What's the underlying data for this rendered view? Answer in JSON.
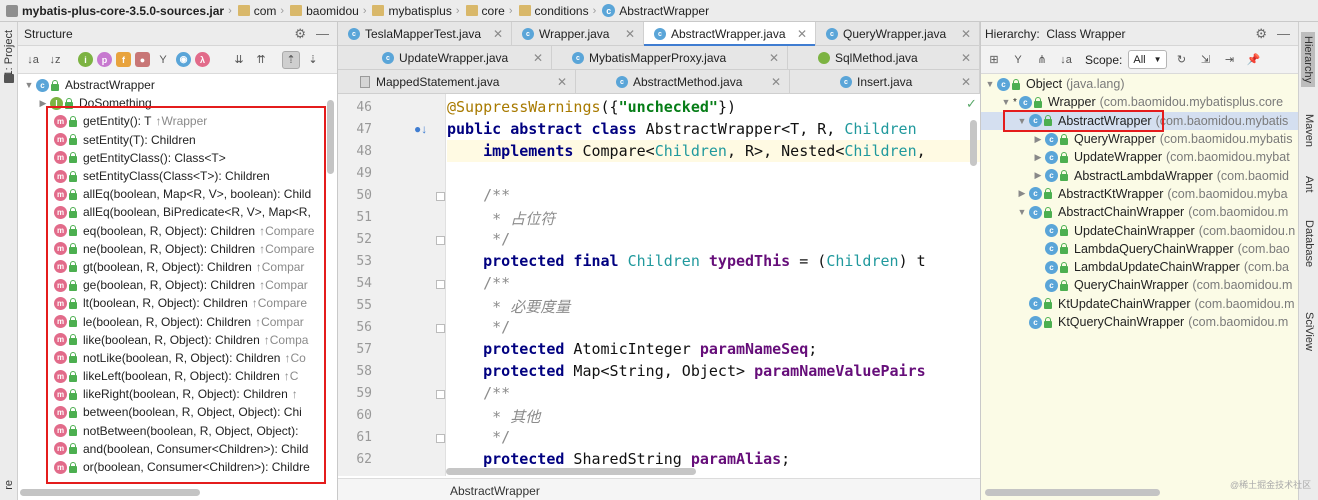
{
  "breadcrumb": [
    {
      "label": "mybatis-plus-core-3.5.0-sources.jar",
      "icon": "jar-icon",
      "bold": true
    },
    {
      "label": "com",
      "icon": "folder-icon"
    },
    {
      "label": "baomidou",
      "icon": "folder-icon"
    },
    {
      "label": "mybatisplus",
      "icon": "folder-icon"
    },
    {
      "label": "core",
      "icon": "folder-icon"
    },
    {
      "label": "conditions",
      "icon": "folder-icon"
    },
    {
      "label": "AbstractWrapper",
      "icon": "class-icon"
    }
  ],
  "left_strip": {
    "project_label": "1: Project",
    "bottom_label": "re"
  },
  "structure": {
    "title": "Structure",
    "root": "AbstractWrapper",
    "child": "DoSomething",
    "methods": [
      {
        "name": "getEntity(): T",
        "hint": "↑Wrapper"
      },
      {
        "name": "setEntity(T): Children",
        "hint": ""
      },
      {
        "name": "getEntityClass(): Class<T>",
        "hint": ""
      },
      {
        "name": "setEntityClass(Class<T>): Children",
        "hint": ""
      },
      {
        "name": "allEq(boolean, Map<R, V>, boolean): Child",
        "hint": ""
      },
      {
        "name": "allEq(boolean, BiPredicate<R, V>, Map<R,",
        "hint": ""
      },
      {
        "name": "eq(boolean, R, Object): Children",
        "hint": "↑Compare"
      },
      {
        "name": "ne(boolean, R, Object): Children",
        "hint": "↑Compare"
      },
      {
        "name": "gt(boolean, R, Object): Children",
        "hint": "↑Compar"
      },
      {
        "name": "ge(boolean, R, Object): Children",
        "hint": "↑Compar"
      },
      {
        "name": "lt(boolean, R, Object): Children",
        "hint": "↑Compare"
      },
      {
        "name": "le(boolean, R, Object): Children",
        "hint": "↑Compar"
      },
      {
        "name": "like(boolean, R, Object): Children",
        "hint": "↑Compa"
      },
      {
        "name": "notLike(boolean, R, Object): Children",
        "hint": "↑Co"
      },
      {
        "name": "likeLeft(boolean, R, Object): Children",
        "hint": "↑C"
      },
      {
        "name": "likeRight(boolean, R, Object): Children",
        "hint": "↑"
      },
      {
        "name": "between(boolean, R, Object, Object): Chi",
        "hint": ""
      },
      {
        "name": "notBetween(boolean, R, Object, Object):",
        "hint": ""
      },
      {
        "name": "and(boolean, Consumer<Children>): Child",
        "hint": ""
      },
      {
        "name": "or(boolean, Consumer<Children>): Childre",
        "hint": ""
      }
    ]
  },
  "editor": {
    "tabs_row1": [
      {
        "label": "TeslaMapperTest.java",
        "icon": "class-icon"
      },
      {
        "label": "Wrapper.java",
        "icon": "class-icon"
      },
      {
        "label": "AbstractWrapper.java",
        "icon": "class-icon",
        "selected": true
      },
      {
        "label": "QueryWrapper.java",
        "icon": "class-icon"
      }
    ],
    "tabs_row2": [
      {
        "label": "UpdateWrapper.java",
        "icon": "class-icon"
      },
      {
        "label": "MybatisMapperProxy.java",
        "icon": "class-icon"
      },
      {
        "label": "SqlMethod.java",
        "icon": "enum-icon"
      }
    ],
    "tabs_row3": [
      {
        "label": "MappedStatement.java",
        "icon": "java-file-icon"
      },
      {
        "label": "AbstractMethod.java",
        "icon": "class-icon"
      },
      {
        "label": "Insert.java",
        "icon": "class-icon"
      }
    ],
    "line_numbers": [
      "46",
      "47",
      "48",
      "49",
      "50",
      "51",
      "52",
      "53",
      "54",
      "55",
      "56",
      "57",
      "58",
      "59",
      "60",
      "61",
      "62"
    ],
    "code": {
      "l46_ann": "@SuppressWarnings",
      "l46_open": "({",
      "l46_str": "\"unchecked\"",
      "l46_close": "})",
      "l47_kw": "public abstract class",
      "l47_rest": " AbstractWrapper<T, R, ",
      "l47_gen": "Children",
      "l48_kw": "implements",
      "l48_rest": " Compare<",
      "l48_gen1": "Children",
      "l48_rest2": ", R>, Nested<",
      "l48_gen2": "Children",
      "l48_rest3": ",",
      "l50": "/**",
      "l51": " * 占位符",
      "l52": " */",
      "l53_kw": "protected final",
      "l53_gen": " Children ",
      "l53_fld": "typedThis",
      "l53_rest": " = (",
      "l53_gen2": "Children",
      "l53_rest2": ") t",
      "l54": "/**",
      "l55": " * 必要度量",
      "l56": " */",
      "l57_kw": "protected",
      "l57_rest": " AtomicInteger ",
      "l57_fld": "paramNameSeq",
      "l57_end": ";",
      "l58_kw": "protected",
      "l58_rest": " Map<String, Object> ",
      "l58_fld": "paramNameValuePairs",
      "l59": "/**",
      "l60": " * 其他",
      "l61": " */",
      "l62_kw": "protected",
      "l62_rest": " SharedString ",
      "l62_fld": "paramAlias",
      "l62_end": ";"
    },
    "status_breadcrumb": "AbstractWrapper"
  },
  "hierarchy": {
    "title": "Hierarchy:",
    "subtitle": "Class Wrapper",
    "scope_label": "Scope:",
    "scope_value": "All",
    "nodes": [
      {
        "name": "Object",
        "pkg": "(java.lang)",
        "level": 0,
        "arrow": "▼"
      },
      {
        "name": "Wrapper",
        "pkg": "(com.baomidou.mybatisplus.core",
        "level": 1,
        "arrow": "▼",
        "star": true
      },
      {
        "name": "AbstractWrapper",
        "pkg": "(com.baomidou.mybatis",
        "level": 2,
        "arrow": "▼",
        "selected": true
      },
      {
        "name": "QueryWrapper",
        "pkg": "(com.baomidou.mybatis",
        "level": 3,
        "arrow": "▶"
      },
      {
        "name": "UpdateWrapper",
        "pkg": "(com.baomidou.mybat",
        "level": 3,
        "arrow": "▶"
      },
      {
        "name": "AbstractLambdaWrapper",
        "pkg": "(com.baomid",
        "level": 3,
        "arrow": "▶"
      },
      {
        "name": "AbstractKtWrapper",
        "pkg": "(com.baomidou.myba",
        "level": 2,
        "arrow": "▶"
      },
      {
        "name": "AbstractChainWrapper",
        "pkg": "(com.baomidou.m",
        "level": 2,
        "arrow": "▼"
      },
      {
        "name": "UpdateChainWrapper",
        "pkg": "(com.baomidou.n",
        "level": 3,
        "arrow": ""
      },
      {
        "name": "LambdaQueryChainWrapper",
        "pkg": "(com.bao",
        "level": 3,
        "arrow": ""
      },
      {
        "name": "LambdaUpdateChainWrapper",
        "pkg": "(com.ba",
        "level": 3,
        "arrow": ""
      },
      {
        "name": "QueryChainWrapper",
        "pkg": "(com.baomidou.m",
        "level": 3,
        "arrow": ""
      },
      {
        "name": "KtUpdateChainWrapper",
        "pkg": "(com.baomidou.m",
        "level": 2,
        "arrow": ""
      },
      {
        "name": "KtQueryChainWrapper",
        "pkg": "(com.baomidou.m",
        "level": 2,
        "arrow": ""
      }
    ]
  },
  "right_strip": [
    "Hierarchy",
    "Maven",
    "Ant",
    "Database",
    "SciView"
  ],
  "watermark": "@稀土掘金技术社区",
  "colors": {
    "highlight_red": "#e41c1c",
    "selected_tab_accent": "#3f7dd1",
    "method_icon": "#e26b8a",
    "class_icon": "#5aa5d8"
  }
}
